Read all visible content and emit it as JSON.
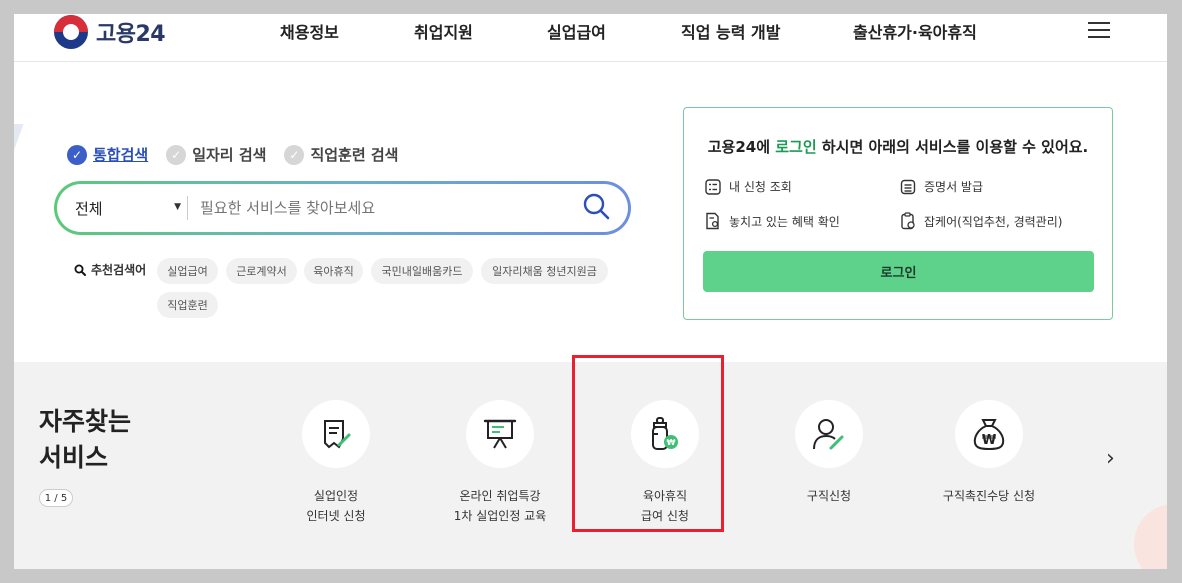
{
  "header": {
    "logo_text": "고용24",
    "nav": [
      "채용정보",
      "취업지원",
      "실업급여",
      "직업 능력 개발",
      "출산휴가·육아휴직"
    ]
  },
  "search": {
    "tabs": [
      {
        "label": "통합검색",
        "active": true
      },
      {
        "label": "일자리 검색",
        "active": false
      },
      {
        "label": "직업훈련 검색",
        "active": false
      }
    ],
    "category": "전체",
    "placeholder": "필요한 서비스를 찾아보세요",
    "recommend_label": "추천검색어",
    "keywords": [
      "실업급여",
      "근로계약서",
      "육아휴직",
      "국민내일배움카드",
      "일자리채움 청년지원금",
      "직업훈련"
    ]
  },
  "login": {
    "msg_prefix": "고용24에 ",
    "msg_highlight": "로그인",
    "msg_suffix": " 하시면 아래의 서비스를 이용할 수 있어요.",
    "services": [
      "내 신청 조회",
      "증명서 발급",
      "놓치고 있는 혜택 확인",
      "잡케어(직업추천, 경력관리)"
    ],
    "button_label": "로그인"
  },
  "frequent": {
    "title_line1": "자주찾는",
    "title_line2": "서비스",
    "pager": "1 / 5",
    "items": [
      {
        "line1": "실업인정",
        "line2": "인터넷 신청",
        "icon": "document-pen-icon"
      },
      {
        "line1": "온라인 취업특강",
        "line2": "1차 실업인정 교육",
        "icon": "presentation-board-icon"
      },
      {
        "line1": "육아휴직",
        "line2": "급여 신청",
        "icon": "baby-bottle-icon"
      },
      {
        "line1": "구직신청",
        "line2": "",
        "icon": "person-pen-icon"
      },
      {
        "line1": "구직촉진수당 신청",
        "line2": "",
        "icon": "money-bag-icon"
      }
    ]
  },
  "colors": {
    "accent_blue": "#3b5ec9",
    "accent_green": "#5ed18a",
    "highlight_red": "#e8202f"
  }
}
